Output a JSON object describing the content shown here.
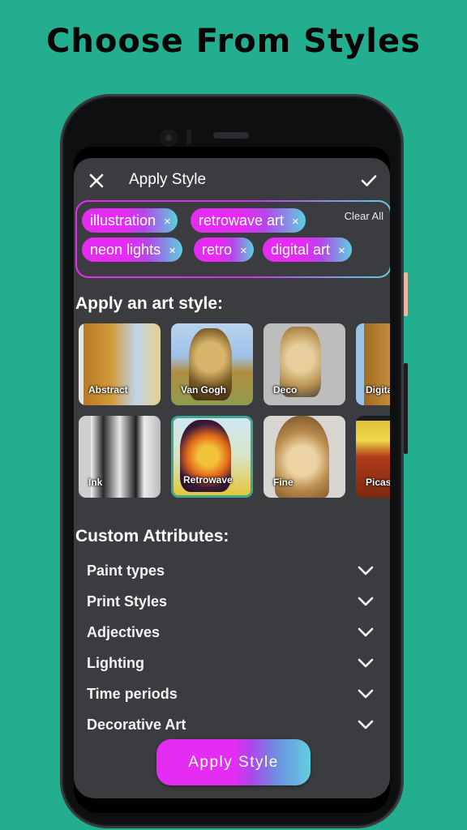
{
  "headline": "Choose From Styles",
  "colors": {
    "background": "#23AE90",
    "app_surface": "#3B3C3F",
    "accent_pink": "#E52CF3",
    "accent_cyan": "#5BD1DF",
    "selected_border": "#3FA88D"
  },
  "appbar": {
    "close_icon": "close-icon",
    "title": "Apply Style",
    "confirm_icon": "check-icon"
  },
  "tags": {
    "clear_all": "Clear All",
    "items": [
      {
        "label": "illustration"
      },
      {
        "label": "retrowave art"
      },
      {
        "label": "neon lights"
      },
      {
        "label": "retro"
      },
      {
        "label": "digital art"
      }
    ],
    "remove_glyph": "×"
  },
  "art_style": {
    "title": "Apply an art style:",
    "tiles": [
      {
        "label": "Abstract",
        "selected": false
      },
      {
        "label": "Van Gogh",
        "selected": false
      },
      {
        "label": "Deco",
        "selected": false
      },
      {
        "label": "Digital",
        "selected": false
      },
      {
        "label": "Ink",
        "selected": false
      },
      {
        "label": "Retrowave",
        "selected": true
      },
      {
        "label": "Fine",
        "selected": false
      },
      {
        "label": "Picasso",
        "selected": false
      }
    ]
  },
  "custom_attributes": {
    "title": "Custom Attributes:",
    "items": [
      {
        "label": "Paint types"
      },
      {
        "label": "Print Styles"
      },
      {
        "label": "Adjectives"
      },
      {
        "label": "Lighting"
      },
      {
        "label": "Time periods"
      },
      {
        "label": "Decorative Art"
      }
    ]
  },
  "apply_button": "Apply Style"
}
